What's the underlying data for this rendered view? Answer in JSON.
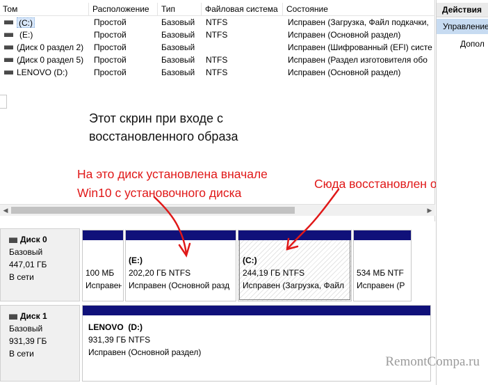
{
  "volume_list": {
    "columns": [
      "Том",
      "Расположение",
      "Тип",
      "Файловая система",
      "Состояние"
    ],
    "rows": [
      {
        "name": "(C:)",
        "location": "Простой",
        "type": "Базовый",
        "fs": "NTFS",
        "status": "Исправен (Загрузка, Файл подкачки,",
        "selected": true
      },
      {
        "name": "(E:)",
        "location": "Простой",
        "type": "Базовый",
        "fs": "NTFS",
        "status": "Исправен (Основной раздел)",
        "selected": false
      },
      {
        "name": "(Диск 0 раздел 2)",
        "location": "Простой",
        "type": "Базовый",
        "fs": "",
        "status": "Исправен (Шифрованный (EFI) систе",
        "selected": false
      },
      {
        "name": "(Диск 0 раздел 5)",
        "location": "Простой",
        "type": "Базовый",
        "fs": "NTFS",
        "status": "Исправен (Раздел изготовителя обо",
        "selected": false
      },
      {
        "name": "LENOVO (D:)",
        "location": "Простой",
        "type": "Базовый",
        "fs": "NTFS",
        "status": "Исправен (Основной раздел)",
        "selected": false
      }
    ]
  },
  "annotations": {
    "restored_image_note": "Этот скрин при входе с восстановленного образа",
    "win10_note_line1": "На это диск установлена вначале",
    "win10_note_line2": "Win10 с установочного диска",
    "restored_here_note": "Сюда восстановлен образ",
    "note_color": "#e01818"
  },
  "disks": [
    {
      "title": "Диск 0",
      "type": "Базовый",
      "size": "447,01 ГБ",
      "state": "В сети",
      "partitions": [
        {
          "name": "",
          "size": "100 МБ",
          "status": "Исправен",
          "hatched": false
        },
        {
          "name": "(E:)",
          "size": "202,20 ГБ NTFS",
          "status": "Исправен (Основной разд",
          "hatched": false
        },
        {
          "name": "(C:)",
          "size": "244,19 ГБ NTFS",
          "status": "Исправен (Загрузка, Файл",
          "hatched": true
        },
        {
          "name": "",
          "size": "534 МБ NTF",
          "status": "Исправен (Р",
          "hatched": false
        }
      ]
    },
    {
      "title": "Диск 1",
      "type": "Базовый",
      "size": "931,39 ГБ",
      "state": "В сети",
      "partitions": [
        {
          "name": "LENOVO  (D:)",
          "size": "931,39 ГБ NTFS",
          "status": "Исправен (Основной раздел)",
          "hatched": false
        }
      ]
    }
  ],
  "actions_pane": {
    "title": "Действия",
    "management": "Управление",
    "more": "Допол"
  },
  "watermark": "RemontCompa.ru",
  "colors": {
    "partition_bar": "#10117a",
    "selection": "#d9e8fb",
    "actions_highlight": "#c7dbf1"
  },
  "icons": {
    "drive": "drive-icon",
    "disk": "disk-icon"
  }
}
